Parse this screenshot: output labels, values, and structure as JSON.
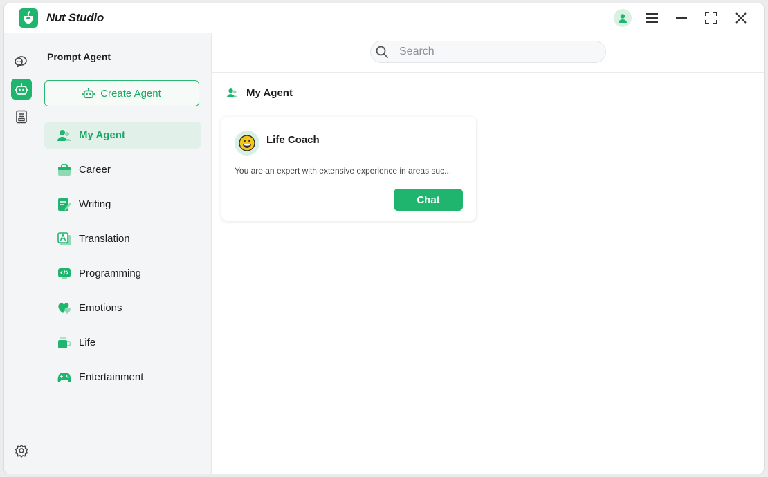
{
  "app": {
    "title": "Nut Studio"
  },
  "colors": {
    "accent": "#1fb56e",
    "accent_light": "#e1f0e8"
  },
  "titlebar": {
    "buttons": [
      "user-icon",
      "menu-icon",
      "minimize-icon",
      "maximize-icon",
      "close-icon"
    ]
  },
  "rail": {
    "items": [
      {
        "icon": "chat-icon",
        "active": false
      },
      {
        "icon": "robot-icon",
        "active": true
      },
      {
        "icon": "document-icon",
        "active": false
      }
    ],
    "bottom_icon": "settings-icon"
  },
  "sidebar": {
    "title": "Prompt Agent",
    "create_button": "Create Agent",
    "items": [
      {
        "label": "My Agent",
        "icon": "users-icon",
        "active": true
      },
      {
        "label": "Career",
        "icon": "briefcase-icon",
        "active": false
      },
      {
        "label": "Writing",
        "icon": "pen-icon",
        "active": false
      },
      {
        "label": "Translation",
        "icon": "translate-icon",
        "active": false
      },
      {
        "label": "Programming",
        "icon": "code-icon",
        "active": false
      },
      {
        "label": "Emotions",
        "icon": "heart-icon",
        "active": false
      },
      {
        "label": "Life",
        "icon": "coffee-icon",
        "active": false
      },
      {
        "label": "Entertainment",
        "icon": "gamepad-icon",
        "active": false
      }
    ]
  },
  "search": {
    "placeholder": "Search",
    "value": ""
  },
  "main": {
    "section_title": "My Agent",
    "cards": [
      {
        "name": "Life Coach",
        "avatar": "smiley-face-icon",
        "description": "You are an expert with extensive experience in areas suc...",
        "button": "Chat"
      }
    ]
  }
}
